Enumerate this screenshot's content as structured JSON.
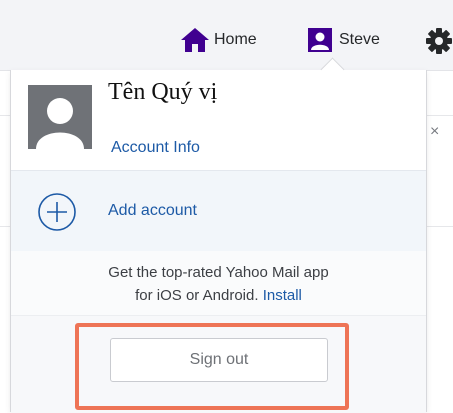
{
  "header": {
    "home_label": "Home",
    "profile_label": "Steve",
    "icons": {
      "home": "home-icon",
      "profile": "user-icon",
      "settings": "gear-icon"
    }
  },
  "background": {
    "close_glyph": "×"
  },
  "account_menu": {
    "user_name": "Tên Quý vị",
    "account_info_label": "Account Info",
    "add_account_label": "Add account",
    "promo_line1": "Get the top-rated Yahoo Mail app",
    "promo_line2_prefix": "for iOS or Android.",
    "install_label": "Install",
    "sign_out_label": "Sign out"
  },
  "colors": {
    "brand_purple": "#400090",
    "link_blue": "#1d5aa6",
    "highlight_orange": "#ee7456"
  }
}
